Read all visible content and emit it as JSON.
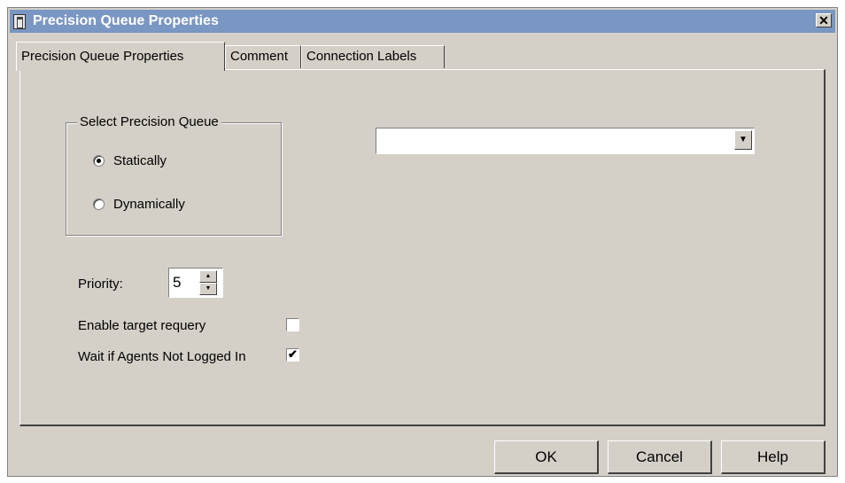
{
  "window": {
    "title": "Precision Queue Properties",
    "close_glyph": "✕"
  },
  "tabs": [
    {
      "label": "Precision Queue Properties",
      "active": true
    },
    {
      "label": "Comment",
      "active": false
    },
    {
      "label": "Connection Labels",
      "active": false
    }
  ],
  "select_group": {
    "legend": "Select Precision Queue",
    "options": [
      {
        "label": "Statically",
        "checked": true
      },
      {
        "label": "Dynamically",
        "checked": false
      }
    ]
  },
  "queue_select": {
    "value": "",
    "arrow": "▼"
  },
  "priority": {
    "label": "Priority:",
    "value": "5",
    "up": "▲",
    "down": "▼"
  },
  "options": {
    "enable_requery": {
      "label": "Enable target requery",
      "checked": false
    },
    "wait_if_agents": {
      "label": "Wait if Agents Not Logged In",
      "checked": true,
      "mark": "✔"
    }
  },
  "buttons": {
    "ok": "OK",
    "cancel": "Cancel",
    "help": "Help"
  },
  "colors": {
    "titlebar": "#7a96c2",
    "dialog_bg": "#d4d0c8"
  }
}
